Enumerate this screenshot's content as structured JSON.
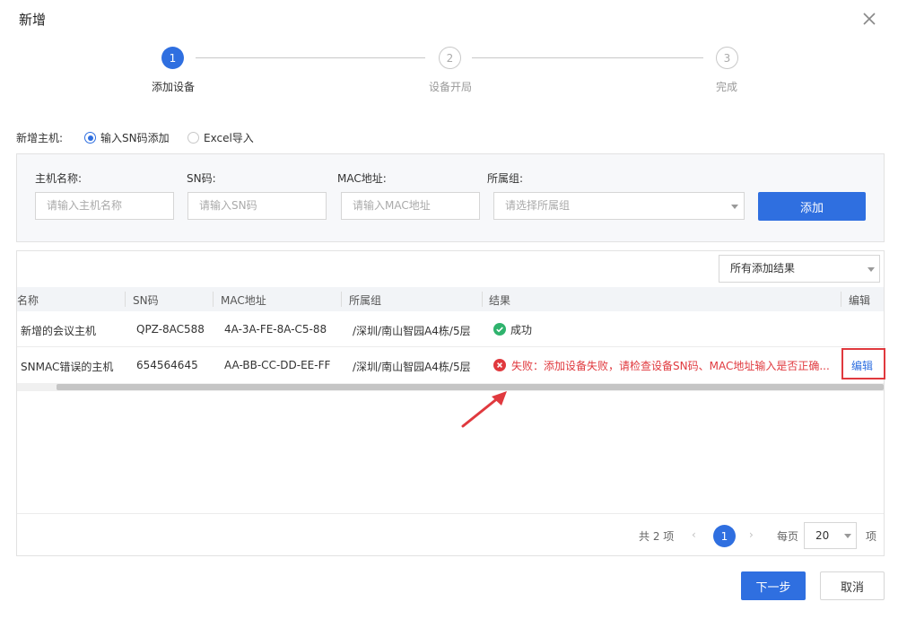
{
  "dialog": {
    "title": "新增",
    "close_icon": "close-icon"
  },
  "steps": [
    {
      "number": "1",
      "label": "添加设备",
      "active": true
    },
    {
      "number": "2",
      "label": "设备开局",
      "active": false
    },
    {
      "number": "3",
      "label": "完成",
      "active": false
    }
  ],
  "add_host": {
    "label": "新增主机:",
    "options": [
      {
        "label": "输入SN码添加",
        "checked": true
      },
      {
        "label": "Excel导入",
        "checked": false
      }
    ]
  },
  "form": {
    "fields": [
      {
        "label": "主机名称:",
        "placeholder": "请输入主机名称"
      },
      {
        "label": "SN码:",
        "placeholder": "请输入SN码"
      },
      {
        "label": "MAC地址:",
        "placeholder": "请输入MAC地址"
      },
      {
        "label": "所属组:",
        "placeholder": "请选择所属组"
      }
    ],
    "add_button": "添加"
  },
  "results": {
    "filter_selected": "所有添加结果",
    "columns": [
      "名称",
      "SN码",
      "MAC地址",
      "所属组",
      "结果",
      "编辑"
    ],
    "rows": [
      {
        "name": "新增的会议主机",
        "sn": "QPZ-8AC588",
        "mac": "4A-3A-FE-8A-C5-88",
        "group": "/深圳/南山智园A4栋/5层",
        "result": "成功",
        "status": "success",
        "edit": ""
      },
      {
        "name": "SNMAC错误的主机",
        "sn": "654564645",
        "mac": "AA-BB-CC-DD-EE-FF",
        "group": "/深圳/南山智园A4栋/5层",
        "result": "失败：添加设备失败，请检查设备SN码、MAC地址输入是否正确...",
        "status": "error",
        "edit": "编辑"
      }
    ]
  },
  "pagination": {
    "total_text": "共 2 项",
    "current_page": "1",
    "per_page_label": "每页",
    "per_page_value": "20",
    "unit": "项"
  },
  "footer": {
    "next_button": "下一步",
    "cancel_button": "取消"
  },
  "colors": {
    "primary": "#2f6fe0",
    "success": "#2fb36d",
    "error": "#e0393e",
    "annotation": "#e0393e"
  }
}
